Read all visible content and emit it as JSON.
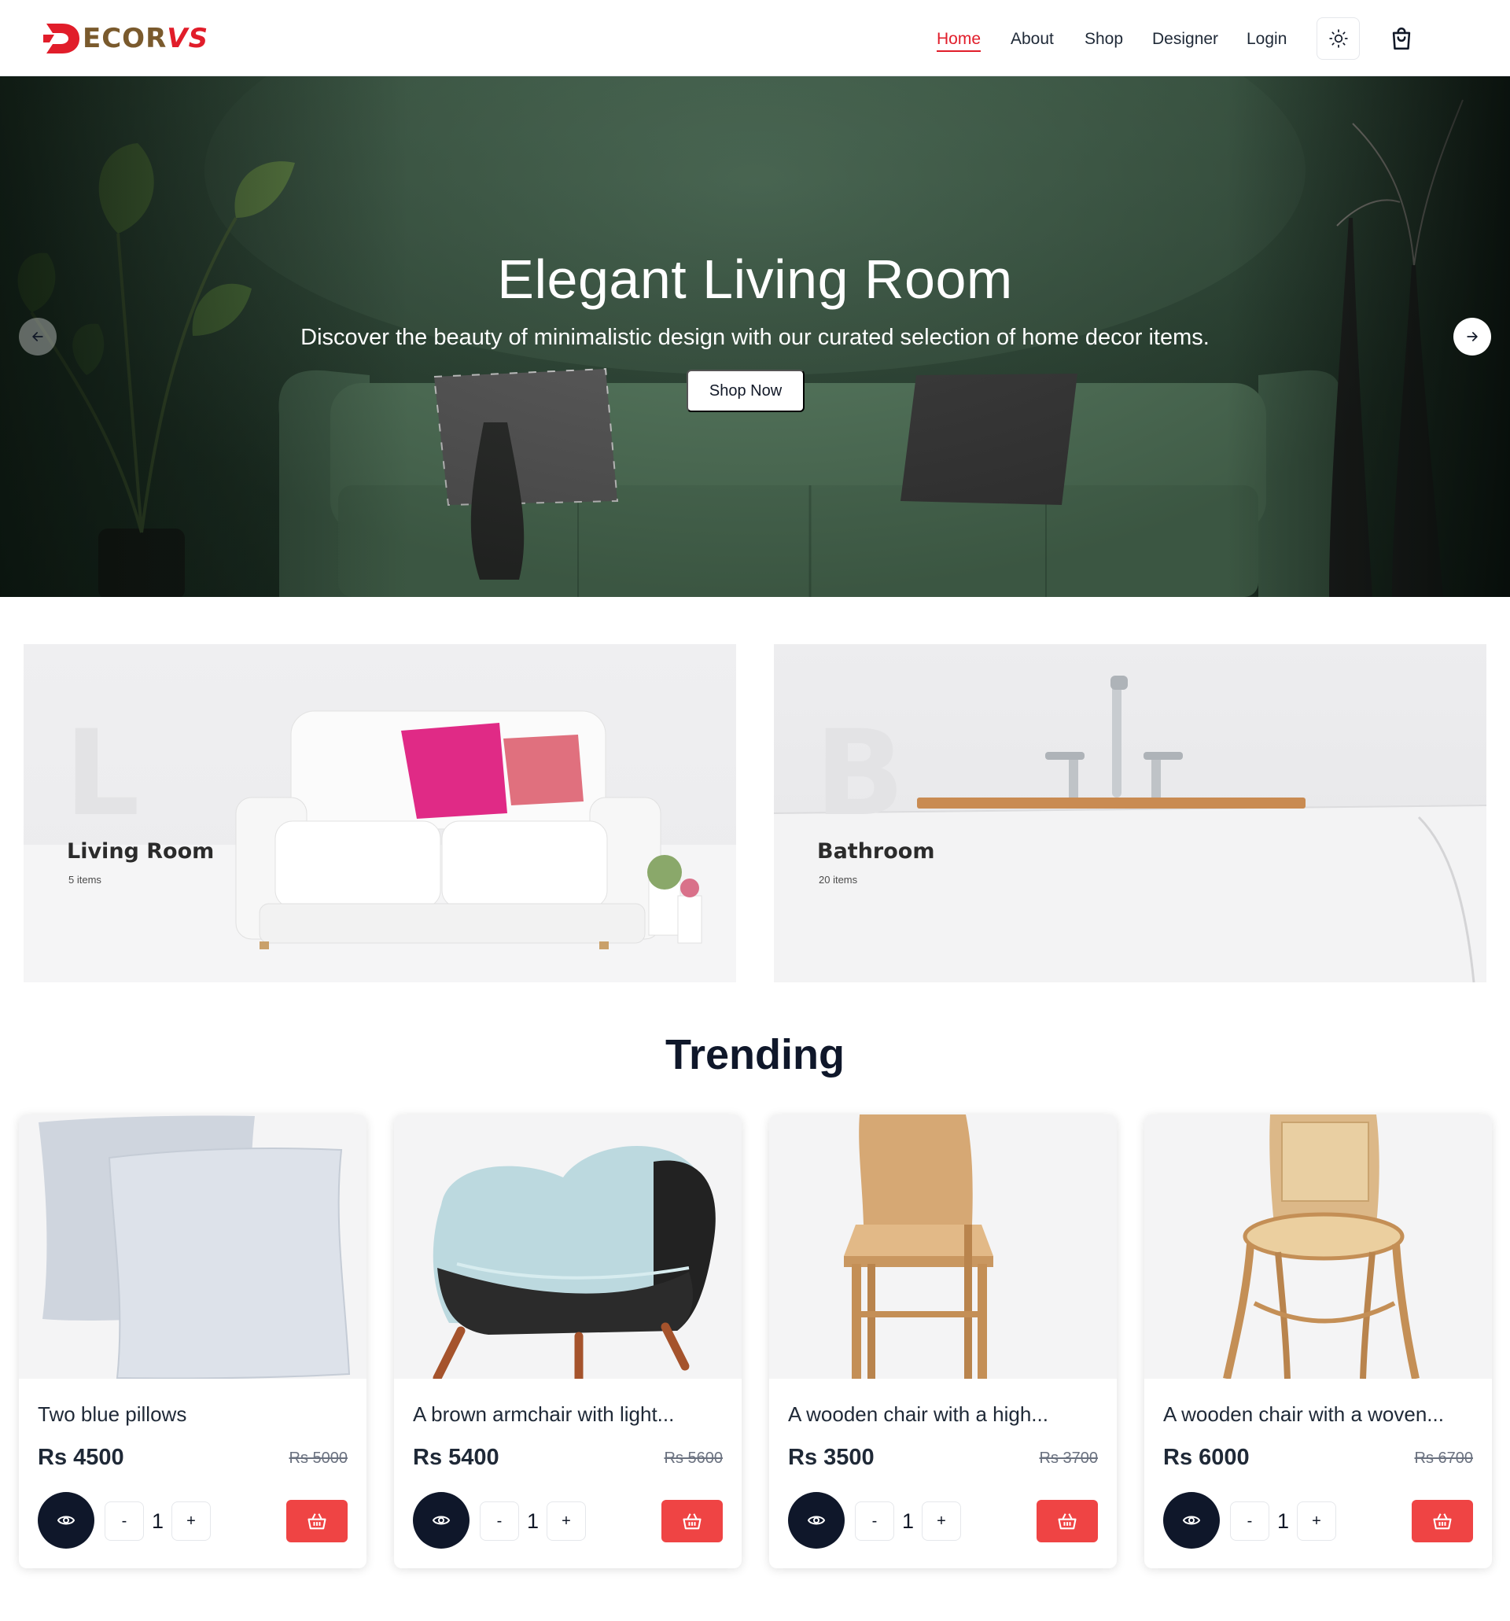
{
  "brand": {
    "prefix": "D",
    "middle": "ECOR",
    "suffix": "VS",
    "accent": "#e11d2a",
    "brown": "#7a5a2d"
  },
  "nav": {
    "links": [
      {
        "label": "Home",
        "active": true
      },
      {
        "label": "About"
      },
      {
        "label": "Shop"
      },
      {
        "label": "Designer"
      },
      {
        "label": "Login"
      }
    ],
    "theme_icon": "sun-icon",
    "cart_icon": "shopping-bag-icon"
  },
  "hero": {
    "title": "Elegant Living Room",
    "subtitle": "Discover the beauty of minimalistic design with our curated selection of home decor items.",
    "cta": "Shop Now",
    "prev_icon": "arrow-left-icon",
    "next_icon": "arrow-right-icon"
  },
  "categories": [
    {
      "letter": "L",
      "name": "Living Room",
      "count": "5 items"
    },
    {
      "letter": "B",
      "name": "Bathroom",
      "count": "20 items"
    }
  ],
  "trending": {
    "title": "Trending",
    "products": [
      {
        "name": "Two blue pillows",
        "price": "Rs 4500",
        "old_price": "Rs 5000",
        "qty": "1",
        "minus": "-",
        "plus": "+"
      },
      {
        "name": "A brown armchair with light...",
        "price": "Rs 5400",
        "old_price": "Rs 5600",
        "qty": "1",
        "minus": "-",
        "plus": "+"
      },
      {
        "name": "A wooden chair with a high...",
        "price": "Rs 3500",
        "old_price": "Rs 3700",
        "qty": "1",
        "minus": "-",
        "plus": "+"
      },
      {
        "name": "A wooden chair with a woven...",
        "price": "Rs 6000",
        "old_price": "Rs 6700",
        "qty": "1",
        "minus": "-",
        "plus": "+"
      }
    ]
  },
  "colors": {
    "accent": "#e11d2a",
    "button_red": "#ef4444",
    "dark": "#0f172a"
  }
}
